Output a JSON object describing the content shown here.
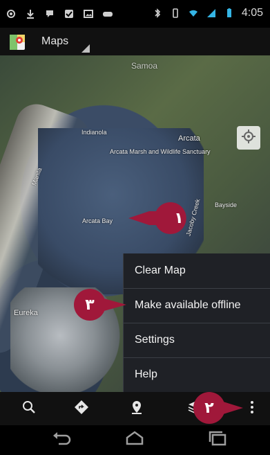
{
  "statusbar": {
    "time": "4:05",
    "left_icons": [
      "gps-icon",
      "download-icon",
      "hangouts-icon",
      "checkmark-icon",
      "image-icon",
      "gamepad-icon"
    ],
    "right_icons": [
      "bluetooth-icon",
      "phone-vibrate-icon",
      "wifi-icon",
      "cellular-icon",
      "battery-icon"
    ]
  },
  "actionbar": {
    "title": "Maps",
    "logo_icon": "maps-logo-icon"
  },
  "map": {
    "labels": {
      "samoa": "Samoa",
      "arcata_bay": "Arcata Bay",
      "arcata": "Arcata",
      "manila": "Manila",
      "bayside": "Bayside",
      "eureka": "Eureka",
      "indianola": "Indianola",
      "arcata_marsh": "Arcata Marsh and Wildlife Sanctuary",
      "jacoby_creek": "Jacoby Creek"
    },
    "locate_icon": "my-location-icon"
  },
  "menu": {
    "items": [
      {
        "label": "Clear Map"
      },
      {
        "label": "Make available offline"
      },
      {
        "label": "Settings"
      },
      {
        "label": "Help"
      }
    ]
  },
  "toolbar": {
    "search_icon": "search-icon",
    "directions_icon": "directions-icon",
    "places_icon": "places-icon",
    "layers_icon": "layers-icon",
    "overflow_icon": "overflow-menu-icon"
  },
  "navbar": {
    "back_icon": "back-icon",
    "home_icon": "home-icon",
    "recents_icon": "recents-icon"
  },
  "callouts": [
    {
      "number": "١",
      "color": "#a0183a"
    },
    {
      "number": "٢",
      "color": "#a0183a"
    },
    {
      "number": "٣",
      "color": "#a0183a"
    }
  ]
}
